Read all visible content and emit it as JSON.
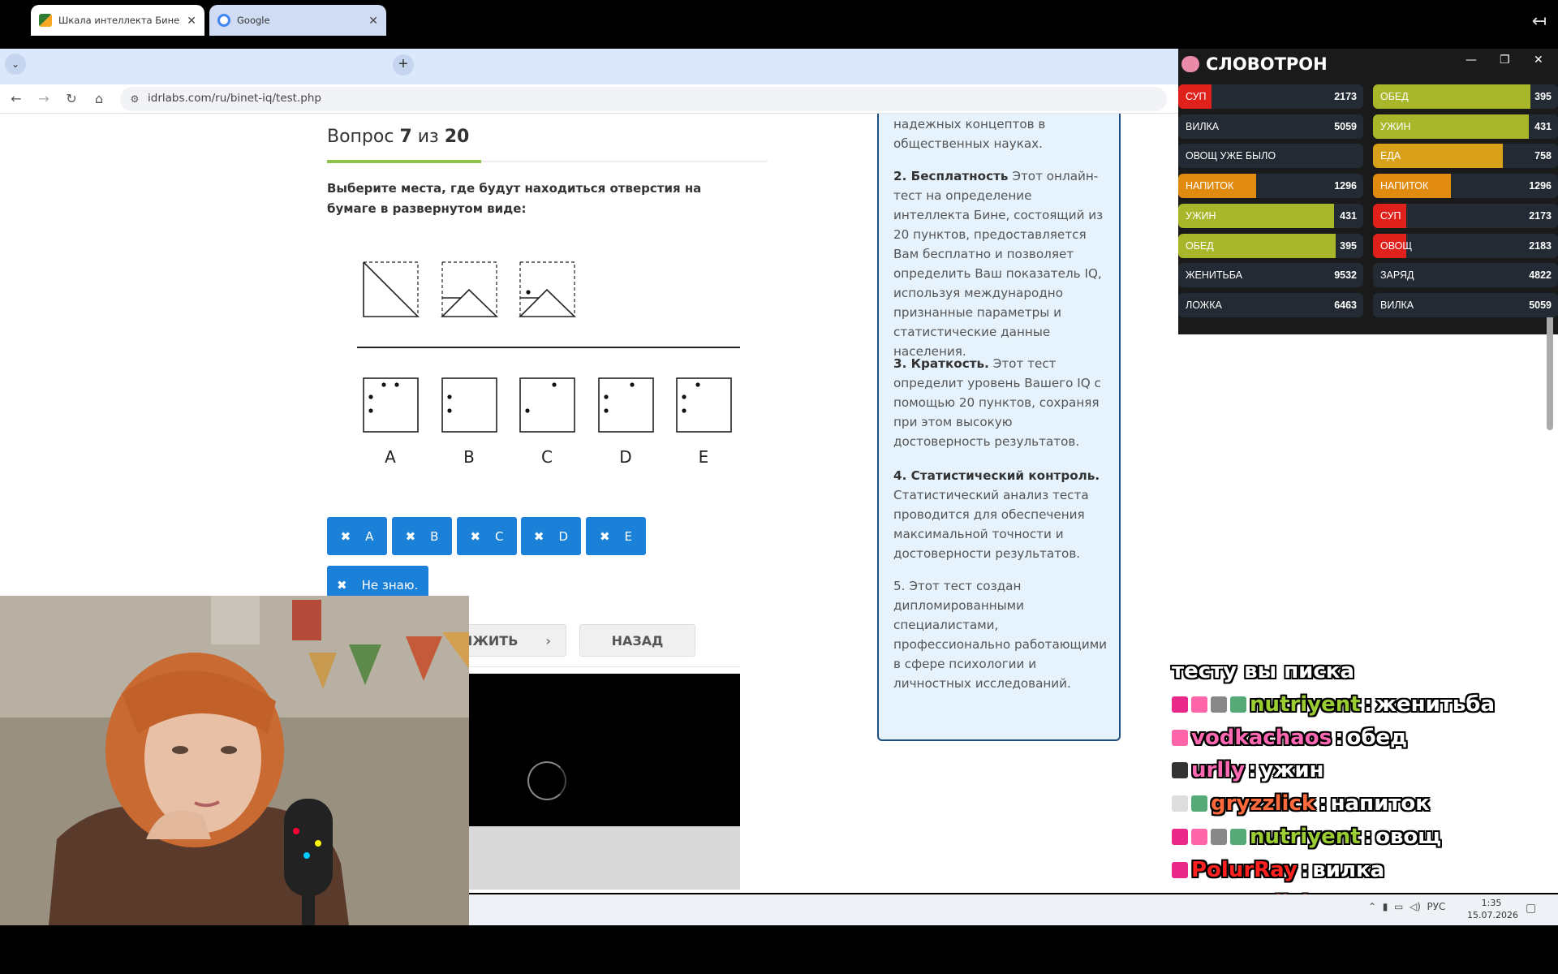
{
  "browser": {
    "tabs": [
      {
        "title": "Шкала интеллекта Бине",
        "active": true
      },
      {
        "title": "Google",
        "active": false
      }
    ],
    "url": "idrlabs.com/ru/binet-iq/test.php"
  },
  "question": {
    "title_prefix": "Вопрос ",
    "current": "7",
    "sep": " из ",
    "total": "20",
    "progress_fraction": 0.35,
    "text": "Выберите места, где будут находиться отверстия на бумаге в развернутом виде:",
    "option_labels": [
      "A",
      "B",
      "C",
      "D",
      "E"
    ]
  },
  "answers": {
    "buttons": [
      "A",
      "B",
      "C",
      "D",
      "E"
    ],
    "dont_know": "Не знаю.",
    "next_fragment": "ЛЖИТЬ",
    "back": "НАЗАД"
  },
  "info_panel": {
    "p0": "надежных концептов в общественных науках.",
    "p2_bold": "2. Бесплатность",
    "p2": " Этот онлайн-тест на определение интеллекта Бине, состоящий из 20 пунктов, предоставляется Вам бесплатно и позволяет определить Ваш показатель IQ, используя международно признанные параметры и статистические данные населения.",
    "p3_bold": "3. Краткость.",
    "p3": " Этот тест определит уровень Вашего IQ с помощью 20 пунктов, сохраняя при этом высокую достоверность результатов.",
    "p4_bold": "4. Статистический контроль.",
    "p4": " Статистический анализ теста проводится для обеспечения максимальной точности и достоверности результатов.",
    "p5": "5. Этот тест создан дипломированными специалистами, профессионально работающими в сфере психологии и личностных исследований."
  },
  "slovotron": {
    "title": "СЛОВОТРОН",
    "left": [
      {
        "word": "СУП",
        "count": "2173",
        "fill": 0.18,
        "color": "#e0201b"
      },
      {
        "word": "ВИЛКА",
        "count": "5059",
        "fill": 0,
        "color": "#232a33"
      },
      {
        "word": "ОВОЩ УЖЕ БЫЛО ИСПОЛЬЗОВАНО",
        "count": "",
        "fill": 0,
        "color": "#232a33"
      },
      {
        "word": "НАПИТОК",
        "count": "1296",
        "fill": 0.42,
        "color": "#e08a10"
      },
      {
        "word": "УЖИН",
        "count": "431",
        "fill": 0.84,
        "color": "#a8b62a"
      },
      {
        "word": "ОБЕД",
        "count": "395",
        "fill": 0.85,
        "color": "#a8b62a"
      },
      {
        "word": "ЖЕНИТЬБА",
        "count": "9532",
        "fill": 0,
        "color": "#232a33"
      },
      {
        "word": "ЛОЖКА",
        "count": "6463",
        "fill": 0,
        "color": "#232a33"
      }
    ],
    "right": [
      {
        "word": "ОБЕД",
        "count": "395",
        "fill": 0.85,
        "color": "#a8b62a"
      },
      {
        "word": "УЖИН",
        "count": "431",
        "fill": 0.84,
        "color": "#a8b62a"
      },
      {
        "word": "ЕДА",
        "count": "758",
        "fill": 0.7,
        "color": "#d9a11a"
      },
      {
        "word": "НАПИТОК",
        "count": "1296",
        "fill": 0.42,
        "color": "#e08a10"
      },
      {
        "word": "СУП",
        "count": "2173",
        "fill": 0.18,
        "color": "#e0201b"
      },
      {
        "word": "ОВОЩ",
        "count": "2183",
        "fill": 0.18,
        "color": "#e0201b"
      },
      {
        "word": "ЗАРЯД",
        "count": "4822",
        "fill": 0,
        "color": "#232a33"
      },
      {
        "word": "ВИЛКА",
        "count": "5059",
        "fill": 0,
        "color": "#232a33"
      }
    ]
  },
  "chat": [
    {
      "user": "",
      "text": "тесту вы писка",
      "color": "#ffffff"
    },
    {
      "user": "nutriyent",
      "text": "женитьба",
      "color": "#9acd32"
    },
    {
      "user": "vodkachaos",
      "text": "обед",
      "color": "#ff69b4"
    },
    {
      "user": "urlly",
      "text": "ужин",
      "color": "#ff69b4"
    },
    {
      "user": "gryzzlick",
      "text": "напиток",
      "color": "#ff6a3d"
    },
    {
      "user": "nutriyent",
      "text": "овощ",
      "color": "#9acd32"
    },
    {
      "user": "PolurRay",
      "text": "вилка",
      "color": "#ff2020"
    },
    {
      "user": "gryzzlick",
      "text": "суп",
      "color": "#ff6a3d"
    }
  ],
  "taskbar": {
    "lang": "РУС",
    "time": "1:35",
    "date": "15.07.2026"
  }
}
